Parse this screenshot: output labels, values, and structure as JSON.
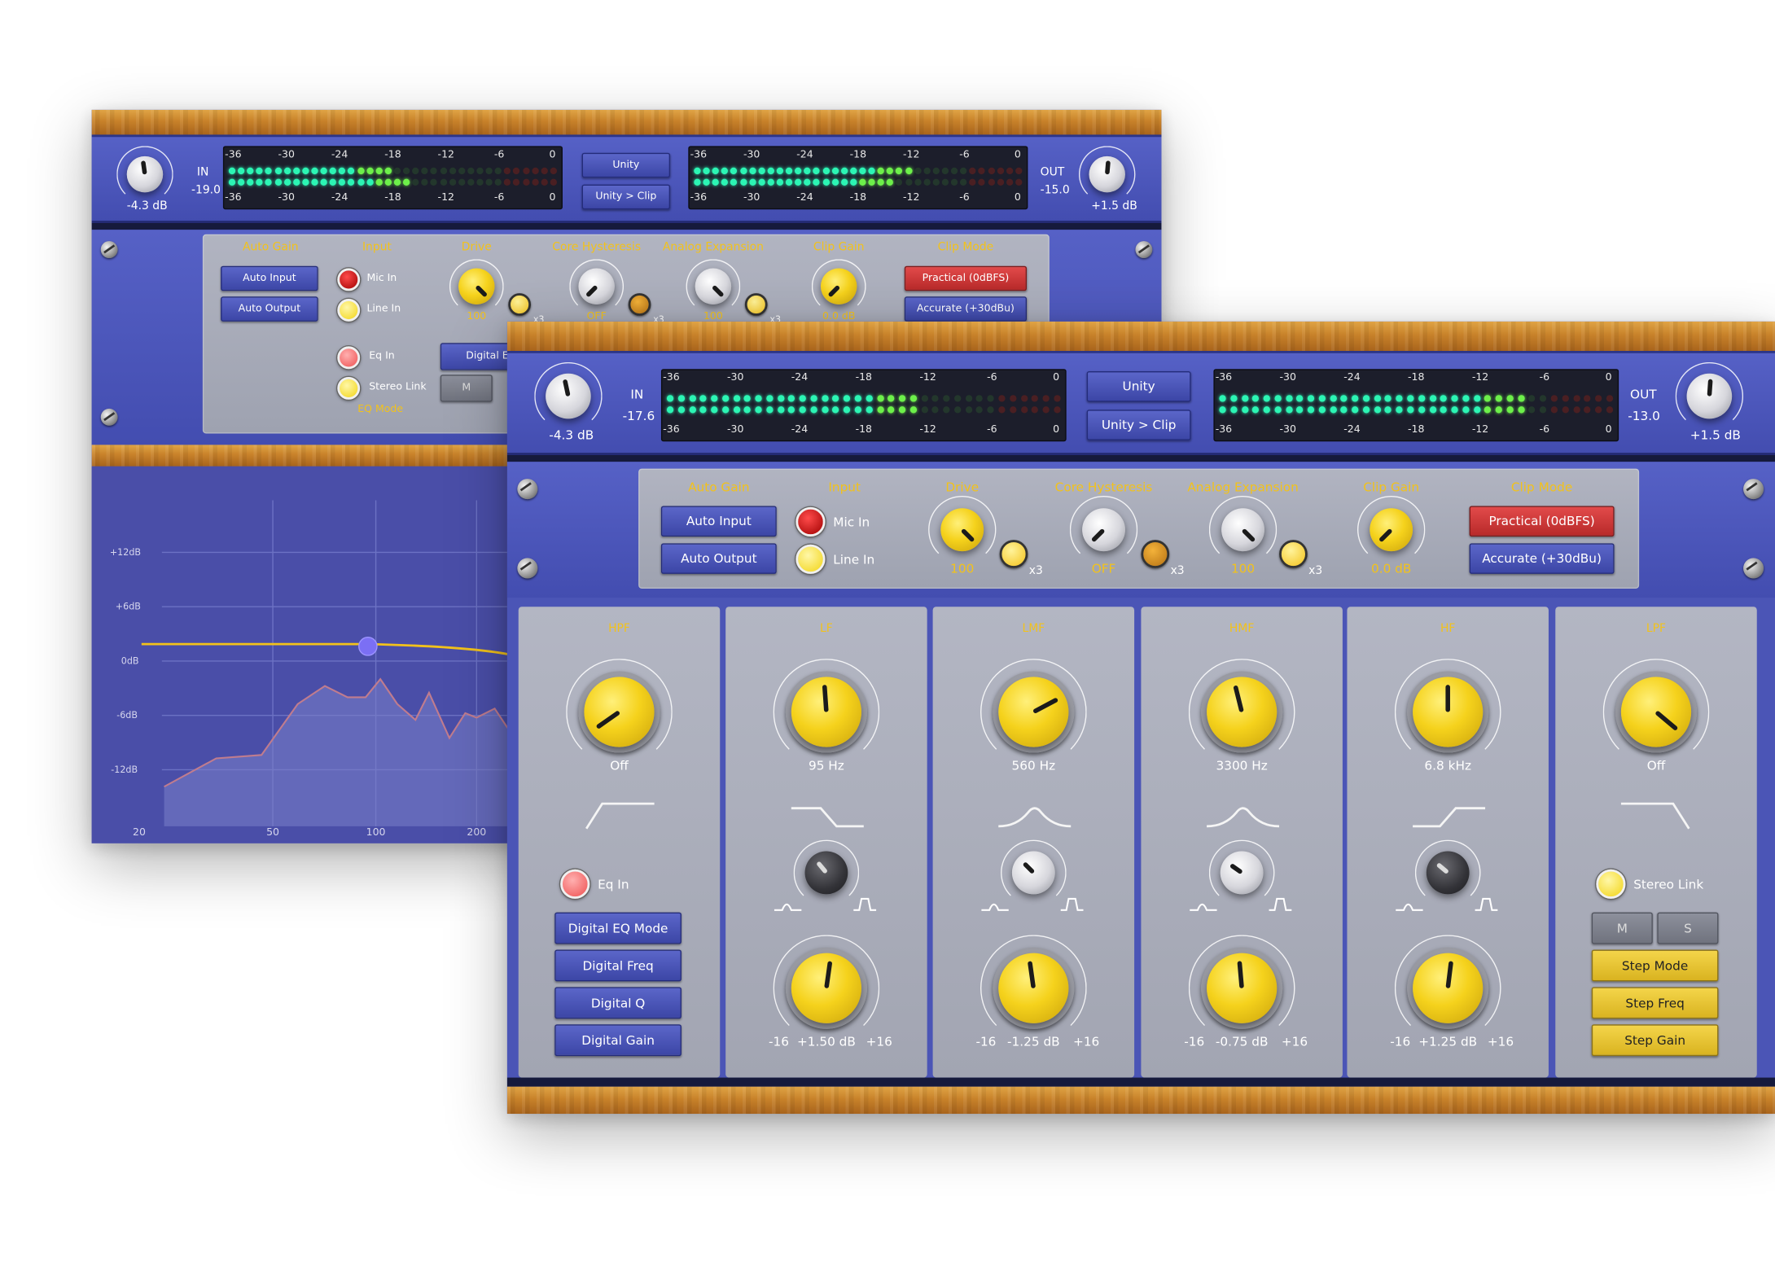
{
  "back_window": {
    "in_label": "IN",
    "in_value": "-19.0",
    "in_gain": "-4.3 dB",
    "out_label": "OUT",
    "out_value": "-15.0",
    "out_gain": "+1.5 dB",
    "unity": "Unity",
    "unity_clip": "Unity > Clip",
    "meter_scale": [
      "-36",
      "-30",
      "-24",
      "-18",
      "-12",
      "-6",
      "0"
    ],
    "section_labels": [
      "Auto Gain",
      "Input",
      "Drive",
      "Core Hysteresis",
      "Analog Expansion",
      "Clip Gain",
      "Clip Mode"
    ],
    "auto_input": "Auto Input",
    "auto_output": "Auto Output",
    "mic_in": "Mic In",
    "line_in": "Line In",
    "drive_value": "100",
    "core_value": "OFF",
    "expansion_value": "100",
    "clip_gain_value": "0.0 dB",
    "x3": "x3",
    "practical": "Practical (0dBFS)",
    "accurate": "Accurate (+30dBu)",
    "eq_in": "Eq In",
    "stereo_link": "Stereo Link",
    "eq_mode": "EQ Mode",
    "digital_eq": "Digital EQ",
    "m": "M",
    "y_labels": [
      "+12dB",
      "+6dB",
      "0dB",
      "-6dB",
      "-12dB"
    ],
    "x_labels": [
      "20",
      "50",
      "100",
      "200"
    ]
  },
  "front_window": {
    "in_label": "IN",
    "in_value": "-17.6",
    "in_gain": "-4.3 dB",
    "out_label": "OUT",
    "out_value": "-13.0",
    "out_gain": "+1.5 dB",
    "unity": "Unity",
    "unity_clip": "Unity > Clip",
    "meter_scale": [
      "-36",
      "-30",
      "-24",
      "-18",
      "-12",
      "-6",
      "0"
    ],
    "section_labels": [
      "Auto Gain",
      "Input",
      "Drive",
      "Core Hysteresis",
      "Analog Expansion",
      "Clip Gain",
      "Clip Mode"
    ],
    "auto_input": "Auto Input",
    "auto_output": "Auto Output",
    "mic_in": "Mic In",
    "line_in": "Line In",
    "drive_value": "100",
    "core_value": "OFF",
    "expansion_value": "100",
    "clip_gain_value": "0.0 dB",
    "x3": "x3",
    "practical": "Practical (0dBFS)",
    "accurate": "Accurate (+30dBu)",
    "bands": [
      {
        "name": "HPF",
        "freq": "Off"
      },
      {
        "name": "LF",
        "freq": "95 Hz",
        "min": "-16",
        "gain": "+1.50 dB",
        "max": "+16"
      },
      {
        "name": "LMF",
        "freq": "560 Hz",
        "min": "-16",
        "gain": "-1.25 dB",
        "max": "+16"
      },
      {
        "name": "HMF",
        "freq": "3300 Hz",
        "min": "-16",
        "gain": "-0.75 dB",
        "max": "+16"
      },
      {
        "name": "HF",
        "freq": "6.8 kHz",
        "min": "-16",
        "gain": "+1.25 dB",
        "max": "+16"
      },
      {
        "name": "LPF",
        "freq": "Off"
      }
    ],
    "eq_in": "Eq In",
    "digital_eq_mode": "Digital EQ Mode",
    "digital_freq": "Digital Freq",
    "digital_q": "Digital Q",
    "digital_gain": "Digital Gain",
    "stereo_link": "Stereo Link",
    "m": "M",
    "s": "S",
    "step_mode": "Step Mode",
    "step_freq": "Step Freq",
    "step_gain": "Step Gain"
  },
  "colors": {
    "rack_blue": "#4b55b6",
    "accent_yellow": "#f2c21b",
    "clip_red": "#d03a3a",
    "meter_green": "#2cf5b4"
  }
}
